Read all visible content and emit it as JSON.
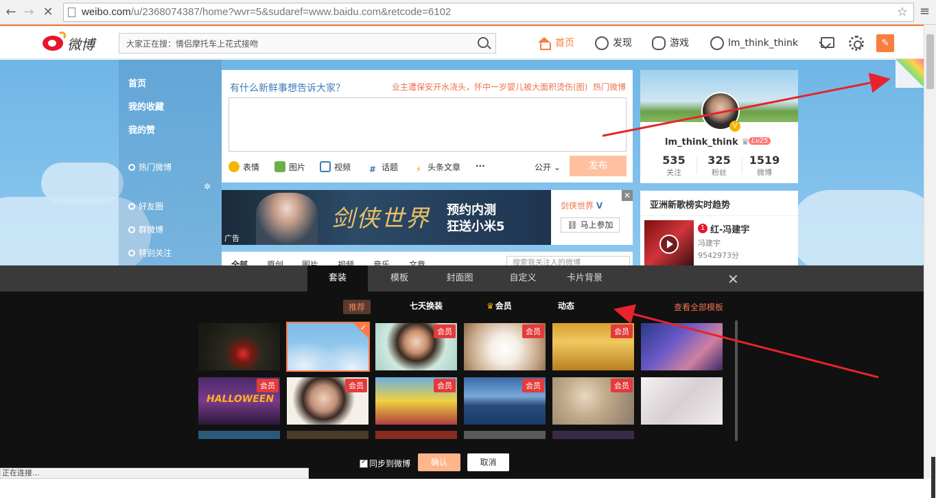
{
  "browser": {
    "url_host": "weibo.com",
    "url_path": "/u/2368074387/home?wvr=5&sudaref=www.baidu.com&retcode=6102",
    "status": "正在连接..."
  },
  "topnav": {
    "logo_text": "微博",
    "search_placeholder": "大家正在搜：情侣摩托车上花式接吻",
    "items": [
      {
        "label": "首页",
        "icon": "home-icon"
      },
      {
        "label": "发现",
        "icon": "discover-icon"
      },
      {
        "label": "游戏",
        "icon": "game-icon"
      },
      {
        "label": "lm_think_think",
        "icon": "user-icon"
      }
    ]
  },
  "leftnav": {
    "items": [
      "首页",
      "我的收藏",
      "我的赞",
      "热门微博",
      "好友圈",
      "群微博",
      "特别关注"
    ]
  },
  "publisher": {
    "hint": "有什么新鲜事想告诉大家？",
    "hot_topic": "业主遭保安开水浇头，怀中一岁婴儿被大面积烫伤(图)",
    "hot_link": "热门微博",
    "tools": [
      "表情",
      "图片",
      "视频",
      "话题",
      "头条文章",
      "···"
    ],
    "visibility": "公开",
    "publish_label": "发布"
  },
  "ad": {
    "title": "剑侠世界",
    "slogan_line1": "预约内测",
    "slogan_line2": "狂送小米5",
    "tag": "广告",
    "brand": "剑侠世界",
    "join": "马上参加",
    "close": "✕"
  },
  "feedtabs": {
    "items": [
      "全部",
      "原创",
      "图片",
      "视频",
      "音乐",
      "文章"
    ],
    "search_placeholder": "搜索我关注人的微博"
  },
  "profile": {
    "name": "lm_think_think",
    "level": "Lv25",
    "stats": [
      {
        "n": "535",
        "l": "关注"
      },
      {
        "n": "325",
        "l": "粉丝"
      },
      {
        "n": "1519",
        "l": "微博"
      }
    ]
  },
  "trend": {
    "header": "亚洲新歌榜实时趋势",
    "rank": "1",
    "song": "红-冯建宇",
    "artist": "冯建宇",
    "score": "9542973分"
  },
  "skin_panel": {
    "tabs": [
      "套装",
      "模板",
      "封面图",
      "自定义",
      "卡片背景"
    ],
    "active_tab": "套装",
    "subtabs": [
      "推荐",
      "七天换装",
      "会员",
      "动态"
    ],
    "all_templates": "查看全部模板",
    "vip_label": "会员",
    "sync_label": "同步到微博",
    "confirm": "确认",
    "cancel": "取消",
    "close": "✕"
  }
}
